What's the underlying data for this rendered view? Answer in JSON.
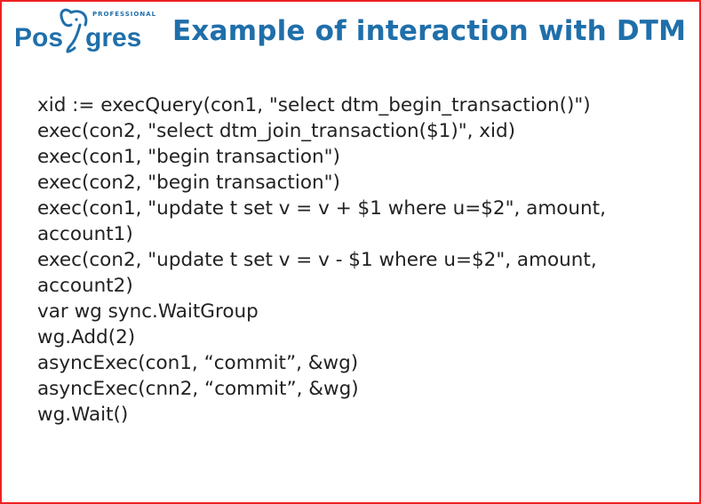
{
  "logo": {
    "text_left": "Pos",
    "text_right": "gres",
    "tagline": "PROFESSIONAL"
  },
  "title": "Example of interaction with DTM",
  "code": {
    "l1": "xid := execQuery(con1, \"select dtm_begin_transaction()\")",
    "l2": "exec(con2, \"select dtm_join_transaction($1)\", xid)",
    "l3": "exec(con1, \"begin transaction\")",
    "l4": "exec(con2, \"begin transaction\")",
    "l5": "exec(con1, \"update t set v = v + $1 where u=$2\", amount, account1)",
    "l6": "exec(con2, \"update t set v = v - $1 where u=$2\", amount, account2)",
    "l7": "var wg sync.WaitGroup",
    "l8": "wg.Add(2)",
    "l9": "asyncExec(con1, “commit”, &wg)",
    "l10": "asyncExec(cnn2, “commit”, &wg)",
    "l11": "wg.Wait()"
  }
}
